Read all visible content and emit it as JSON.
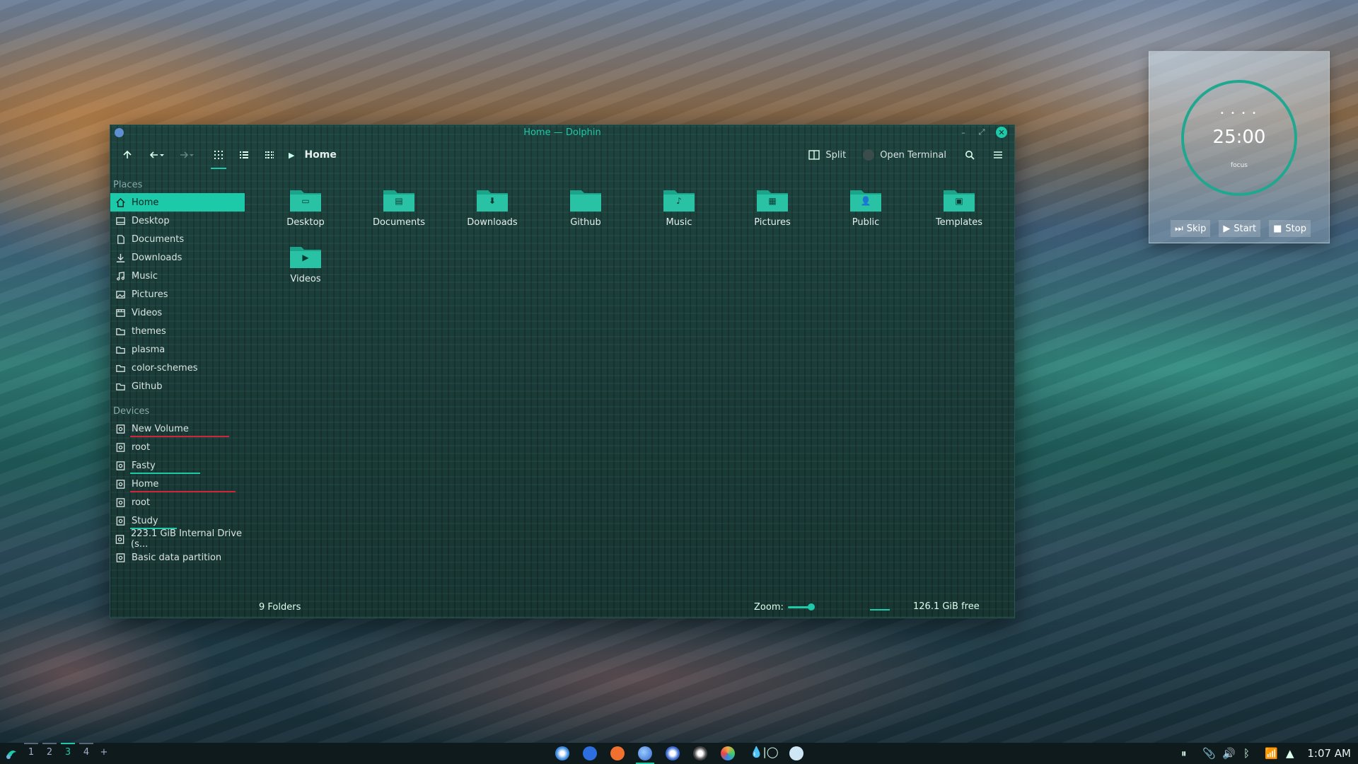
{
  "colors": {
    "accent": "#1cc9a8",
    "window_bg": "#1b3a37",
    "taskbar_bg": "#0f1a1c",
    "capacity_red": "#d0263a",
    "capacity_teal": "#1cc9a8"
  },
  "window": {
    "title": "Home — Dolphin"
  },
  "toolbar": {
    "up_icon": "arrow-up-icon",
    "back_icon": "arrow-left-icon",
    "forward_icon": "arrow-right-icon",
    "view_icons": "icons-view-icon",
    "view_compact": "compact-view-icon",
    "view_details": "details-view-icon",
    "breadcrumb": "Home",
    "split_label": "Split",
    "terminal_label": "Open Terminal",
    "search_icon": "search-icon",
    "menu_icon": "hamburger-menu-icon"
  },
  "sidebar": {
    "places_header": "Places",
    "places": [
      {
        "label": "Home",
        "icon": "home-icon"
      },
      {
        "label": "Desktop",
        "icon": "desktop-icon"
      },
      {
        "label": "Documents",
        "icon": "document-icon"
      },
      {
        "label": "Downloads",
        "icon": "download-icon"
      },
      {
        "label": "Music",
        "icon": "music-icon"
      },
      {
        "label": "Pictures",
        "icon": "picture-icon"
      },
      {
        "label": "Videos",
        "icon": "video-icon"
      },
      {
        "label": "themes",
        "icon": "folder-icon"
      },
      {
        "label": "plasma",
        "icon": "folder-icon"
      },
      {
        "label": "color-schemes",
        "icon": "folder-icon"
      },
      {
        "label": "Github",
        "icon": "folder-icon"
      }
    ],
    "devices_header": "Devices",
    "devices": [
      {
        "label": "New Volume",
        "usage": 0.85,
        "color": "red"
      },
      {
        "label": "root",
        "usage": 0,
        "color": "none"
      },
      {
        "label": "Fasty",
        "usage": 0.6,
        "color": "teal"
      },
      {
        "label": "Home",
        "usage": 0.9,
        "color": "red"
      },
      {
        "label": "root",
        "usage": 0,
        "color": "none"
      },
      {
        "label": "Study",
        "usage": 0.4,
        "color": "teal"
      },
      {
        "label": "223.1 GiB Internal Drive (s...",
        "usage": 0,
        "color": "none"
      },
      {
        "label": "Basic data partition",
        "usage": 0,
        "color": "none"
      }
    ]
  },
  "folders": [
    {
      "label": "Desktop",
      "icon": "desktop-folder-icon"
    },
    {
      "label": "Documents",
      "icon": "documents-folder-icon"
    },
    {
      "label": "Downloads",
      "icon": "downloads-folder-icon"
    },
    {
      "label": "Github",
      "icon": "folder-icon"
    },
    {
      "label": "Music",
      "icon": "music-folder-icon"
    },
    {
      "label": "Pictures",
      "icon": "pictures-folder-icon"
    },
    {
      "label": "Public",
      "icon": "public-folder-icon"
    },
    {
      "label": "Templates",
      "icon": "templates-folder-icon"
    },
    {
      "label": "Videos",
      "icon": "videos-folder-icon"
    }
  ],
  "statusbar": {
    "count": "9 Folders",
    "zoom_label": "Zoom:",
    "free": "126.1 GiB free"
  },
  "pomodoro": {
    "dots": "• • • •",
    "time": "25:00",
    "mode": "focus",
    "skip": "Skip",
    "start": "Start",
    "stop": "Stop"
  },
  "taskbar": {
    "desktops": [
      "1",
      "2",
      "3",
      "4"
    ],
    "active_desktop": "3",
    "add": "+",
    "clock": "1:07 AM"
  }
}
